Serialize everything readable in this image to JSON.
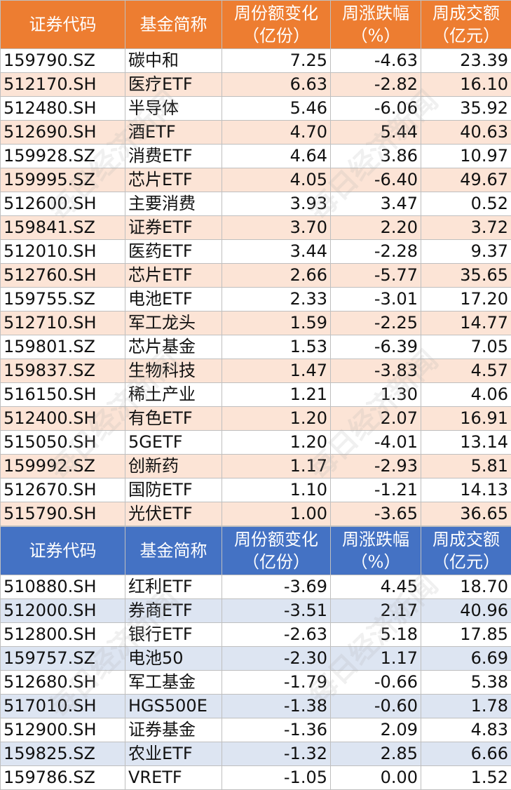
{
  "header_top": {
    "code": "证券代码",
    "name": "基金简称",
    "share_change": [
      "周份额变化",
      "（亿份）"
    ],
    "weekly_change": [
      "周涨跌幅",
      "（%）"
    ],
    "turnover": [
      "周成交额",
      "（亿元）"
    ]
  },
  "inflow_rows": [
    {
      "code": "159790.SZ",
      "name": "碳中和",
      "share": "7.25",
      "pct": "-4.63",
      "turnover": "23.39"
    },
    {
      "code": "512170.SH",
      "name": "医疗ETF",
      "share": "6.63",
      "pct": "-2.82",
      "turnover": "16.10"
    },
    {
      "code": "512480.SH",
      "name": "半导体",
      "share": "5.46",
      "pct": "-6.06",
      "turnover": "35.92"
    },
    {
      "code": "512690.SH",
      "name": "酒ETF",
      "share": "4.70",
      "pct": "5.44",
      "turnover": "40.63"
    },
    {
      "code": "159928.SZ",
      "name": "消费ETF",
      "share": "4.64",
      "pct": "3.86",
      "turnover": "10.97"
    },
    {
      "code": "159995.SZ",
      "name": "芯片ETF",
      "share": "4.05",
      "pct": "-6.40",
      "turnover": "49.67"
    },
    {
      "code": "512600.SH",
      "name": "主要消费",
      "share": "3.93",
      "pct": "3.47",
      "turnover": "0.52"
    },
    {
      "code": "159841.SZ",
      "name": "证券ETF",
      "share": "3.70",
      "pct": "2.20",
      "turnover": "3.72"
    },
    {
      "code": "512010.SH",
      "name": "医药ETF",
      "share": "3.44",
      "pct": "-2.28",
      "turnover": "9.37"
    },
    {
      "code": "512760.SH",
      "name": "芯片ETF",
      "share": "2.66",
      "pct": "-5.77",
      "turnover": "35.65"
    },
    {
      "code": "159755.SZ",
      "name": "电池ETF",
      "share": "2.33",
      "pct": "-3.01",
      "turnover": "17.20"
    },
    {
      "code": "512710.SH",
      "name": "军工龙头",
      "share": "1.59",
      "pct": "-2.25",
      "turnover": "14.77"
    },
    {
      "code": "159801.SZ",
      "name": "芯片基金",
      "share": "1.53",
      "pct": "-6.39",
      "turnover": "7.05"
    },
    {
      "code": "159837.SZ",
      "name": "生物科技",
      "share": "1.47",
      "pct": "-3.83",
      "turnover": "4.57"
    },
    {
      "code": "516150.SH",
      "name": "稀土产业",
      "share": "1.21",
      "pct": "1.30",
      "turnover": "4.06"
    },
    {
      "code": "512400.SH",
      "name": "有色ETF",
      "share": "1.20",
      "pct": "2.07",
      "turnover": "16.91"
    },
    {
      "code": "515050.SH",
      "name": "5GETF",
      "share": "1.20",
      "pct": "-4.01",
      "turnover": "13.14"
    },
    {
      "code": "159992.SZ",
      "name": "创新药",
      "share": "1.17",
      "pct": "-2.93",
      "turnover": "5.81"
    },
    {
      "code": "512670.SH",
      "name": "国防ETF",
      "share": "1.10",
      "pct": "-1.21",
      "turnover": "14.13"
    },
    {
      "code": "515790.SH",
      "name": "光伏ETF",
      "share": "1.00",
      "pct": "-3.65",
      "turnover": "36.65"
    }
  ],
  "header_bottom": {
    "code": "证券代码",
    "name": "基金简称",
    "share_change": [
      "周份额变化",
      "（亿份）"
    ],
    "weekly_change": [
      "周涨跌幅",
      "（%）"
    ],
    "turnover": [
      "周成交额",
      "（亿元）"
    ]
  },
  "outflow_rows": [
    {
      "code": "510880.SH",
      "name": "红利ETF",
      "share": "-3.69",
      "pct": "4.45",
      "turnover": "18.70"
    },
    {
      "code": "512000.SH",
      "name": "券商ETF",
      "share": "-3.51",
      "pct": "2.17",
      "turnover": "40.96"
    },
    {
      "code": "512800.SH",
      "name": "银行ETF",
      "share": "-2.63",
      "pct": "5.18",
      "turnover": "17.85"
    },
    {
      "code": "159757.SZ",
      "name": "电池50",
      "share": "-2.30",
      "pct": "1.17",
      "turnover": "6.69"
    },
    {
      "code": "512680.SH",
      "name": "军工基金",
      "share": "-1.79",
      "pct": "-0.66",
      "turnover": "5.38"
    },
    {
      "code": "517010.SH",
      "name": "HGS500E",
      "share": "-1.38",
      "pct": "-0.60",
      "turnover": "1.78"
    },
    {
      "code": "512900.SH",
      "name": "证券基金",
      "share": "-1.36",
      "pct": "2.09",
      "turnover": "4.83"
    },
    {
      "code": "159825.SZ",
      "name": "农业ETF",
      "share": "-1.32",
      "pct": "2.85",
      "turnover": "6.66"
    },
    {
      "code": "159786.SZ",
      "name": "VRETF",
      "share": "-1.05",
      "pct": "0.00",
      "turnover": "1.52"
    }
  ],
  "watermark_text": "每日经济新闻",
  "colors": {
    "header_top": "#ed7d31",
    "band_top": "#fce4d6",
    "header_bottom": "#4472c4",
    "band_bottom": "#dde5f2"
  }
}
